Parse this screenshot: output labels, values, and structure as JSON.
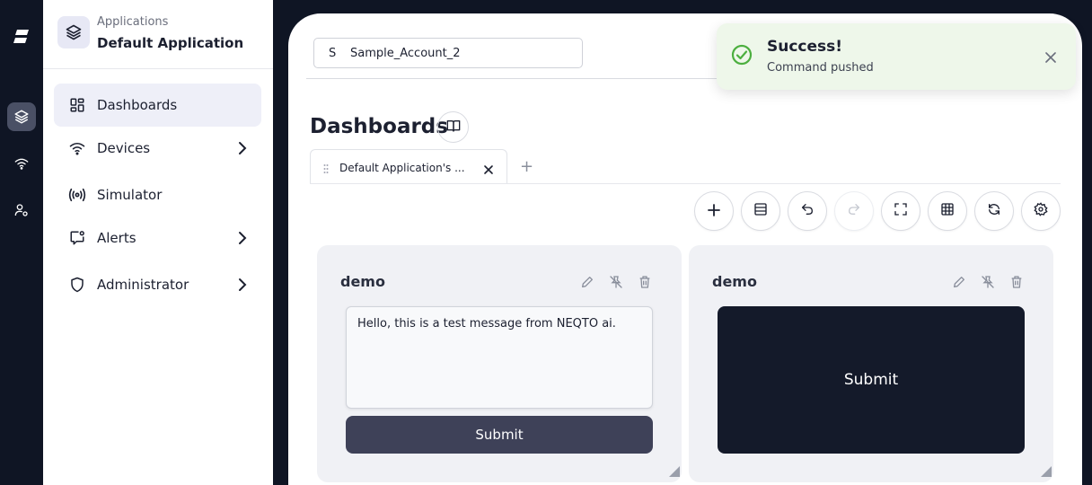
{
  "sidebar": {
    "app_kicker": "Applications",
    "app_name": "Default Application",
    "items": [
      {
        "label": "Dashboards",
        "icon": "dashboard-icon",
        "active": true
      },
      {
        "label": "Devices",
        "icon": "wifi-icon",
        "has_submenu": true
      },
      {
        "label": "Simulator",
        "icon": "broadcast-icon"
      },
      {
        "label": "Alerts",
        "icon": "alert-message-icon",
        "has_submenu": true
      },
      {
        "label": "Administrator",
        "icon": "shield-icon",
        "has_submenu": true
      }
    ]
  },
  "rail": {
    "icons": [
      "logo-icon",
      "layers-icon",
      "wifi-icon",
      "user-settings-icon"
    ]
  },
  "account": {
    "initial": "S",
    "name": "Sample_Account_2"
  },
  "page": {
    "title": "Dashboards"
  },
  "tabs": [
    {
      "label": "Default Application's ..."
    }
  ],
  "toolbar": [
    "add-icon",
    "layout-icon",
    "undo-icon",
    "redo-icon",
    "fullscreen-icon",
    "grid-icon",
    "refresh-icon",
    "settings-icon"
  ],
  "widgets": [
    {
      "title": "demo",
      "message": "Hello, this is a test message from NEQTO ai.",
      "submit_label": "Submit"
    },
    {
      "title": "demo",
      "submit_label": "Submit"
    }
  ],
  "toast": {
    "title": "Success!",
    "message": "Command pushed"
  },
  "colors": {
    "dark_bg": "#0f1524",
    "accent": "#3e4158",
    "success": "#4caf3f",
    "toast_bg": "#eef7ea"
  }
}
